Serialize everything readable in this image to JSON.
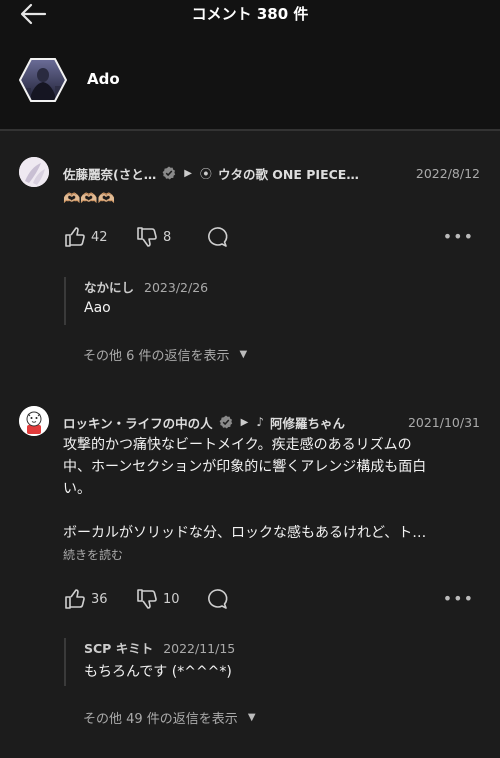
{
  "header": {
    "title": "コメント 380 件",
    "back_icon": "arrow-left-icon"
  },
  "artist": {
    "name": "Ado"
  },
  "comments": [
    {
      "user": "佐藤麗奈(さと…",
      "song": "ウタの歌 ONE PIECE…",
      "song_icon": "disc-icon",
      "date": "2022/8/12",
      "body": "🫶🏼🫶🏼🫶🏼",
      "likes": "42",
      "dislikes": "8",
      "reply": {
        "user": "なかにし",
        "date": "2023/2/26",
        "body": "Aao"
      },
      "show_more": "その他 6 件の返信を表示"
    },
    {
      "user": "ロッキン・ライフの中の人",
      "song": "阿修羅ちゃん",
      "song_icon": "music-note-icon",
      "date": "2021/10/31",
      "body_lines": [
        "攻撃的かつ痛快なビートメイク。疾走感のあるリズムの",
        "中、ホーンセクションが印象的に響くアレンジ構成も面白",
        "い。",
        "",
        "ボーカルがソリッドな分、ロックな感もあるけれど、ト…"
      ],
      "read_more": "続きを読む",
      "likes": "36",
      "dislikes": "10",
      "reply": {
        "user": "SCP キミト",
        "date": "2022/11/15",
        "body": "もちろんです (*^^^*)"
      },
      "show_more": "その他 49 件の返信を表示"
    }
  ]
}
